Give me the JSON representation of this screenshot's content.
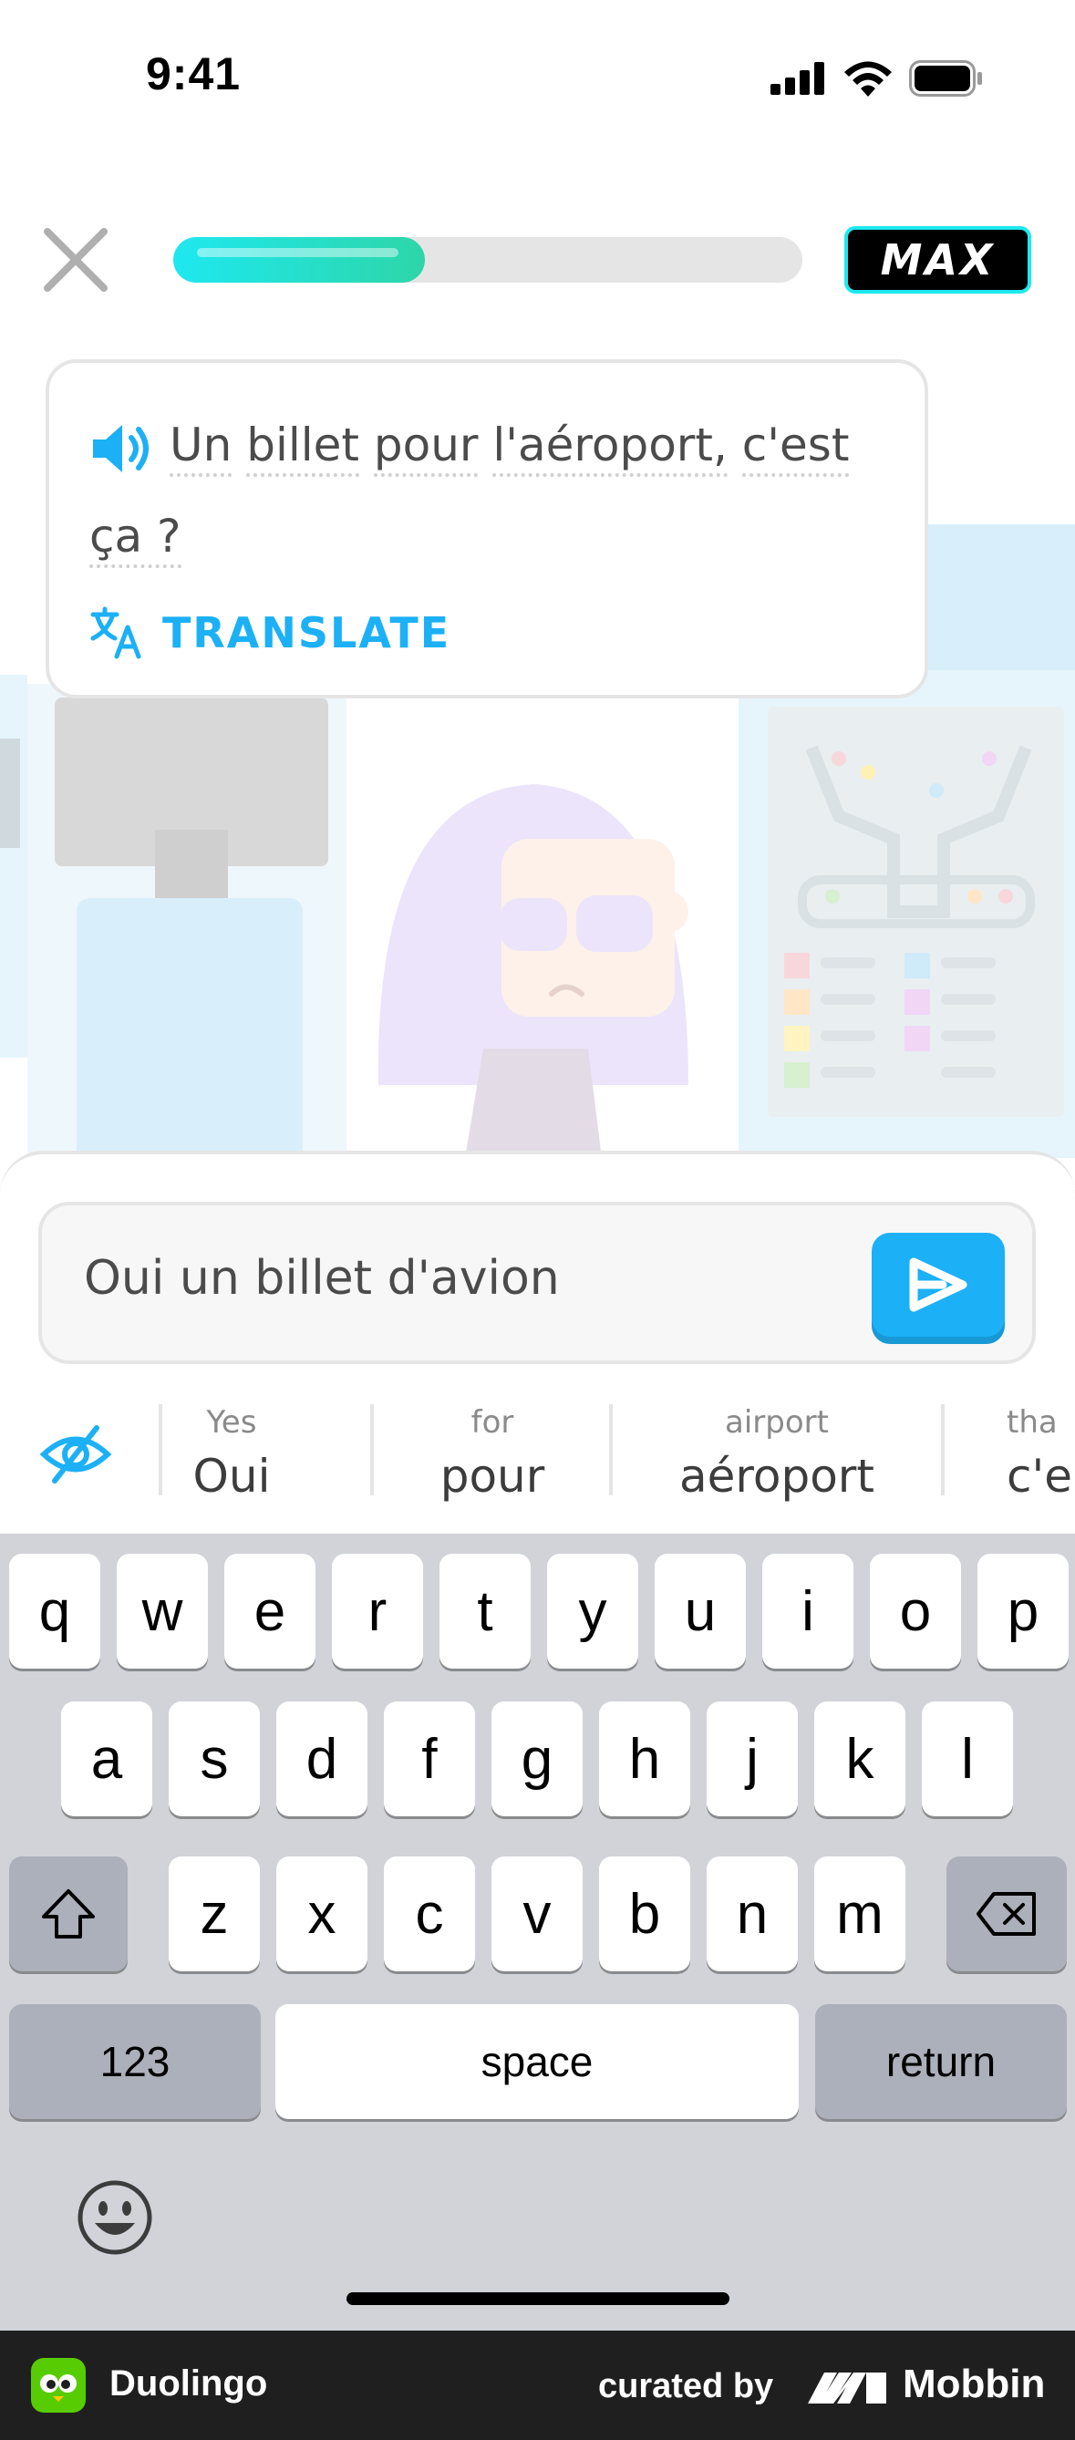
{
  "status_bar": {
    "time": "9:41"
  },
  "lesson": {
    "progress": 0.4,
    "badge": "MAX"
  },
  "prompt": {
    "words": [
      "Un",
      "billet",
      "pour",
      "l'aéroport,",
      "c'est",
      "ça ?"
    ],
    "translate_label": "TRANSLATE"
  },
  "answer": {
    "value": "Oui un billet d'avion"
  },
  "hints": [
    {
      "translation": "Yes",
      "word": "Oui"
    },
    {
      "translation": "for",
      "word": "pour"
    },
    {
      "translation": "airport",
      "word": "aéroport"
    },
    {
      "translation": "tha",
      "word": "c'e"
    }
  ],
  "keyboard": {
    "row1": [
      "q",
      "w",
      "e",
      "r",
      "t",
      "y",
      "u",
      "i",
      "o",
      "p"
    ],
    "row2": [
      "a",
      "s",
      "d",
      "f",
      "g",
      "h",
      "j",
      "k",
      "l"
    ],
    "row3": [
      "z",
      "x",
      "c",
      "v",
      "b",
      "n",
      "m"
    ],
    "numbers_label": "123",
    "space_label": "space",
    "return_label": "return"
  },
  "footer": {
    "app_name": "Duolingo",
    "curated_by": "curated by",
    "brand": "Mobbin"
  },
  "colors": {
    "accent_blue": "#1cb0f6",
    "progress_gradient_start": "#1ee8f0",
    "progress_gradient_end": "#2dd6a8",
    "duolingo_green": "#58cc02"
  },
  "icons": {
    "close": "close-icon",
    "speaker": "speaker-icon",
    "translate": "translate-icon",
    "send": "send-arrow-icon",
    "hide_hints": "eye-slash-icon",
    "shift": "shift-icon",
    "backspace": "backspace-icon",
    "emoji": "emoji-icon"
  }
}
